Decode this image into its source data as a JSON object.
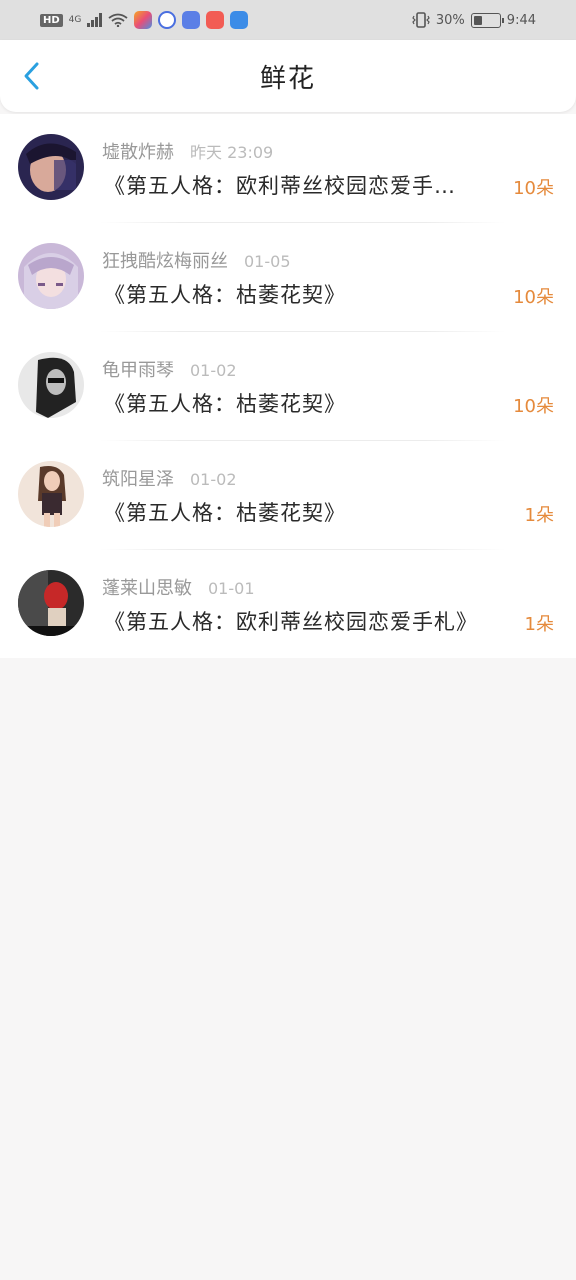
{
  "status_bar": {
    "hd": "HD",
    "network": "4G",
    "battery_percent": "30%",
    "time": "9:44"
  },
  "header": {
    "title": "鲜花"
  },
  "colors": {
    "accent_back": "#2aa0e0",
    "count_color": "#e58a3c"
  },
  "items": [
    {
      "user": "墟散炸赫",
      "time": "昨天 23:09",
      "gift": "《第五人格：欧利蒂丝校园恋爱手…",
      "count": "10朵"
    },
    {
      "user": "狂拽酷炫梅丽丝",
      "time": "01-05",
      "gift": "《第五人格：枯萎花契》",
      "count": "10朵"
    },
    {
      "user": "龟甲雨琴",
      "time": "01-02",
      "gift": "《第五人格：枯萎花契》",
      "count": "10朵"
    },
    {
      "user": "筑阳星泽",
      "time": "01-02",
      "gift": "《第五人格：枯萎花契》",
      "count": "1朵"
    },
    {
      "user": "蓬莱山思敏",
      "time": "01-01",
      "gift": "《第五人格：欧利蒂丝校园恋爱手札》",
      "count": "1朵"
    }
  ]
}
